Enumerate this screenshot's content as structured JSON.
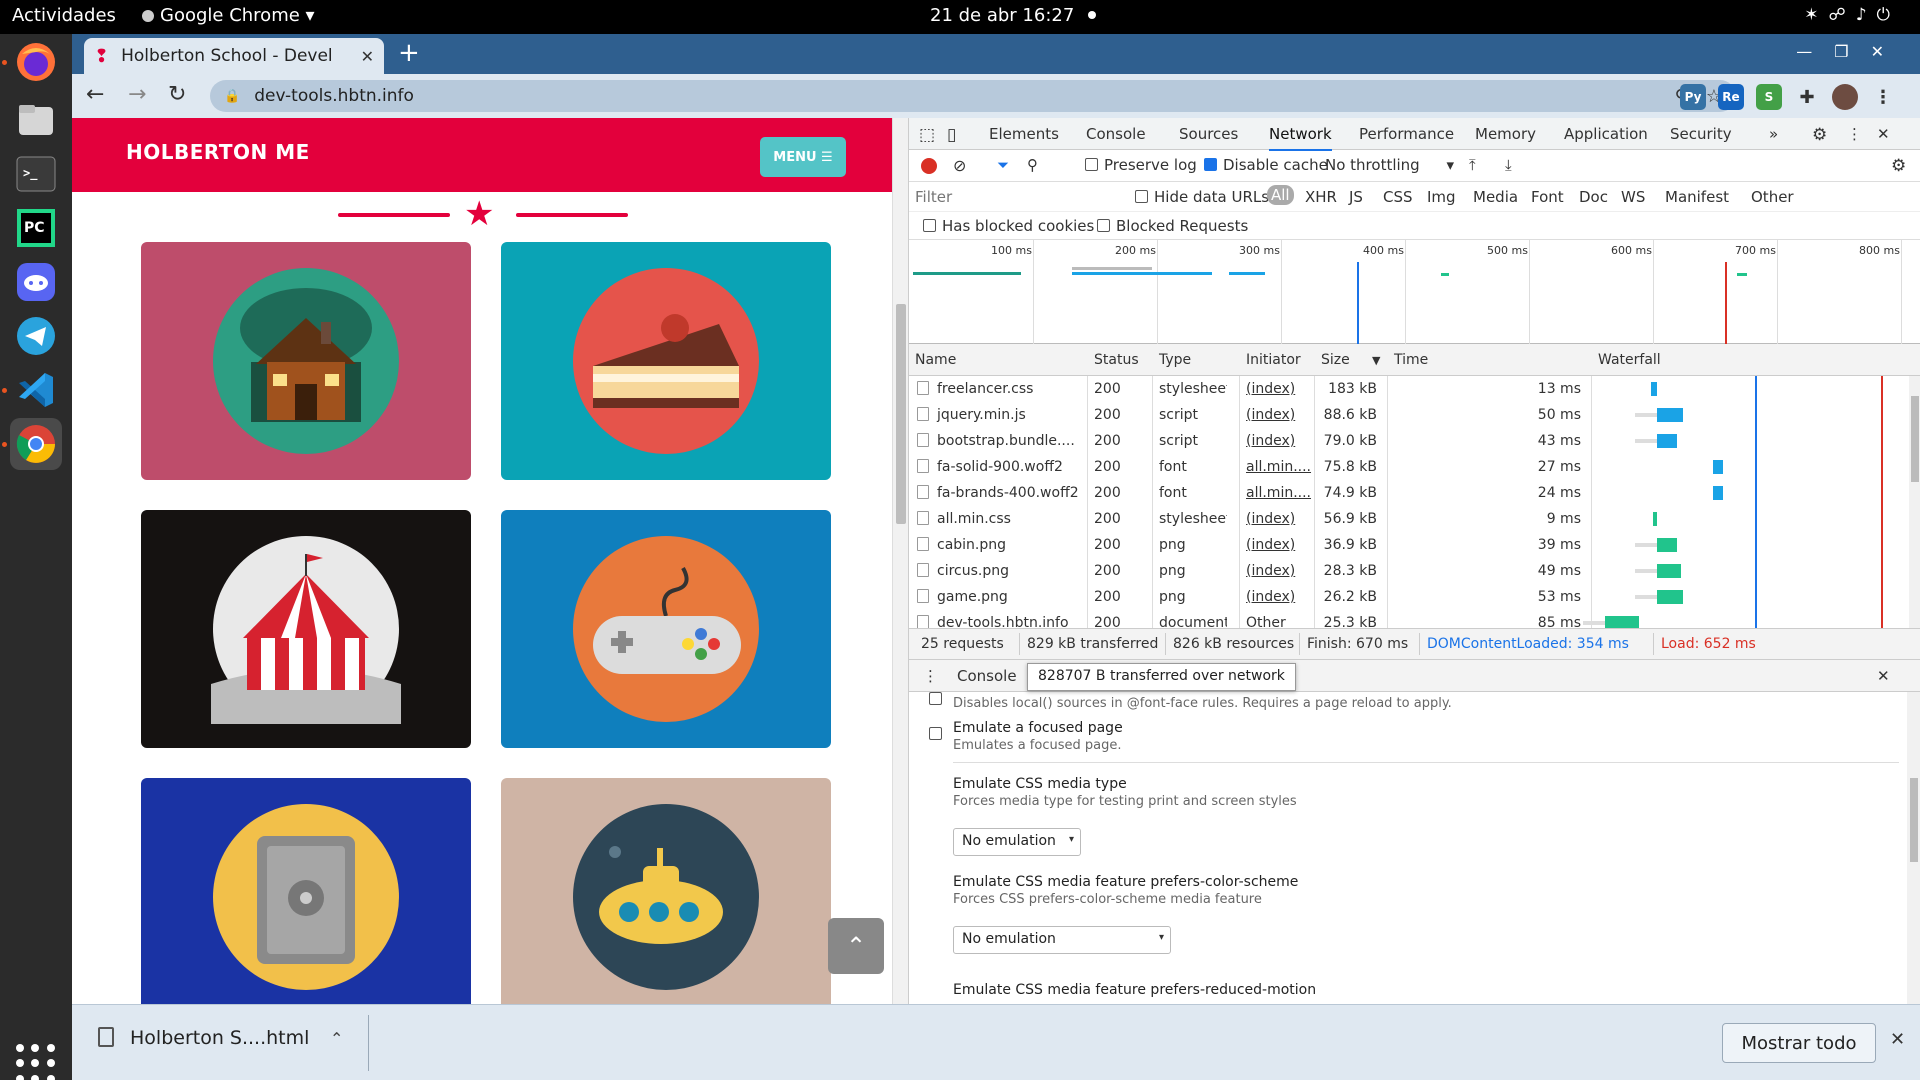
{
  "os": {
    "activities": "Actividades",
    "app_name": "Google Chrome",
    "app_menu_arrow": "▾",
    "clock": "21 de abr  16:27"
  },
  "browser": {
    "tab_title": "Holberton School - Devel",
    "url": "dev-tools.hbtn.info"
  },
  "page": {
    "site_title": "HOLBERTON ME",
    "menu_label": "MENU ☰",
    "cards": [
      {
        "name": "cabin",
        "color": "#be4d6b"
      },
      {
        "name": "cake",
        "color": "#0aa3b5"
      },
      {
        "name": "circus",
        "color": "#151211"
      },
      {
        "name": "game",
        "color": "#0f7fbd"
      },
      {
        "name": "safe",
        "color": "#1a33a4"
      },
      {
        "name": "submarine",
        "color": "#cfb4a5"
      }
    ]
  },
  "devtools": {
    "tabs": [
      "Elements",
      "Console",
      "Sources",
      "Network",
      "Performance",
      "Memory",
      "Application",
      "Security"
    ],
    "active_tab": "Network",
    "more_tabs": "»",
    "preserve_log": "Preserve log",
    "disable_cache": "Disable cache",
    "throttling": "No throttling",
    "filter_placeholder": "Filter",
    "hide_data_urls": "Hide data URLs",
    "type_filters": [
      "All",
      "XHR",
      "JS",
      "CSS",
      "Img",
      "Media",
      "Font",
      "Doc",
      "WS",
      "Manifest",
      "Other"
    ],
    "has_blocked_cookies": "Has blocked cookies",
    "blocked_requests": "Blocked Requests",
    "timeline_labels": [
      "100 ms",
      "200 ms",
      "300 ms",
      "400 ms",
      "500 ms",
      "600 ms",
      "700 ms",
      "800 ms"
    ],
    "columns": [
      "Name",
      "Status",
      "Type",
      "Initiator",
      "Size",
      "Time",
      "Waterfall"
    ],
    "requests": [
      {
        "name": "freelancer.css",
        "status": "200",
        "type": "stylesheet",
        "initiator": "(index)",
        "size": "183 kB",
        "time": "13 ms"
      },
      {
        "name": "jquery.min.js",
        "status": "200",
        "type": "script",
        "initiator": "(index)",
        "size": "88.6 kB",
        "time": "50 ms"
      },
      {
        "name": "bootstrap.bundle....",
        "status": "200",
        "type": "script",
        "initiator": "(index)",
        "size": "79.0 kB",
        "time": "43 ms"
      },
      {
        "name": "fa-solid-900.woff2",
        "status": "200",
        "type": "font",
        "initiator": "all.min....",
        "size": "75.8 kB",
        "time": "27 ms"
      },
      {
        "name": "fa-brands-400.woff2",
        "status": "200",
        "type": "font",
        "initiator": "all.min....",
        "size": "74.9 kB",
        "time": "24 ms"
      },
      {
        "name": "all.min.css",
        "status": "200",
        "type": "stylesheet",
        "initiator": "(index)",
        "size": "56.9 kB",
        "time": "9 ms"
      },
      {
        "name": "cabin.png",
        "status": "200",
        "type": "png",
        "initiator": "(index)",
        "size": "36.9 kB",
        "time": "39 ms"
      },
      {
        "name": "circus.png",
        "status": "200",
        "type": "png",
        "initiator": "(index)",
        "size": "28.3 kB",
        "time": "49 ms"
      },
      {
        "name": "game.png",
        "status": "200",
        "type": "png",
        "initiator": "(index)",
        "size": "26.2 kB",
        "time": "53 ms"
      },
      {
        "name": "dev-tools.hbtn.info",
        "status": "200",
        "type": "document",
        "initiator": "Other",
        "size": "25.3 kB",
        "time": "85 ms"
      }
    ],
    "summary": {
      "requests": "25 requests",
      "transferred": "829 kB transferred",
      "resources": "826 kB resources",
      "finish": "Finish: 670 ms",
      "dom_loaded": "DOMContentLoaded: 354 ms",
      "load": "Load: 652 ms"
    },
    "drawer": {
      "console_tab": "Console",
      "tooltip": "828707 B transferred over network",
      "local_fonts_desc": "Disables local() sources in @font-face rules. Requires a page reload to apply.",
      "focused_title": "Emulate a focused page",
      "focused_desc": "Emulates a focused page.",
      "media_type_title": "Emulate CSS media type",
      "media_type_desc": "Forces media type for testing print and screen styles",
      "media_type_value": "No emulation",
      "color_scheme_title": "Emulate CSS media feature prefers-color-scheme",
      "color_scheme_desc": "Forces CSS prefers-color-scheme media feature",
      "color_scheme_value": "No emulation",
      "reduced_motion_title": "Emulate CSS media feature prefers-reduced-motion"
    }
  },
  "downloads": {
    "item": "Holberton S....html",
    "show_all": "Mostrar todo"
  }
}
